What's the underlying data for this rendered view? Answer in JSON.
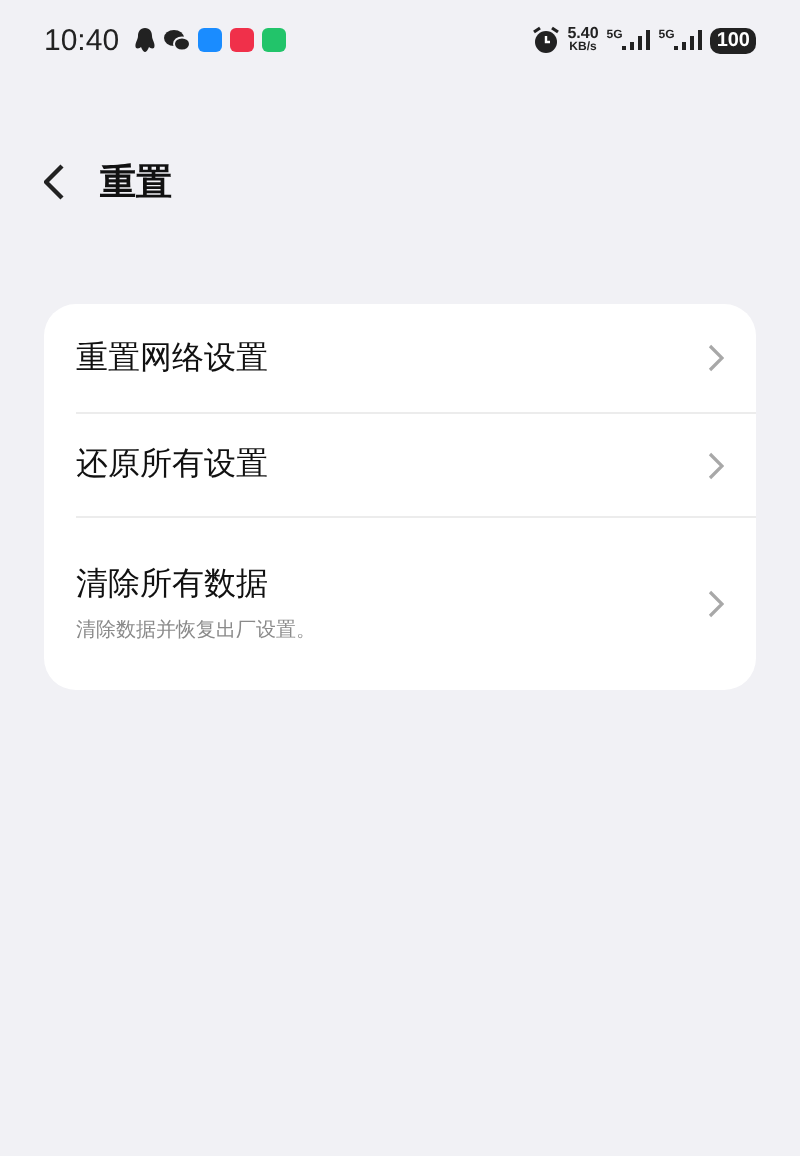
{
  "status_bar": {
    "time": "10:40",
    "net_speed": "5.40",
    "net_unit": "KB/s",
    "signals": [
      {
        "label": "5G"
      },
      {
        "label": "5G"
      }
    ],
    "battery": "100"
  },
  "header": {
    "title": "重置"
  },
  "items": [
    {
      "title": "重置网络设置"
    },
    {
      "title": "还原所有设置"
    },
    {
      "title": "清除所有数据",
      "subtitle": "清除数据并恢复出厂设置。"
    }
  ]
}
